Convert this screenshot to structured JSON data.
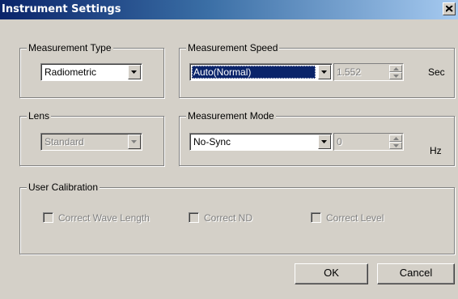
{
  "window": {
    "title": "Instrument Settings"
  },
  "measurement_type": {
    "label": "Measurement Type",
    "value": "Radiometric"
  },
  "measurement_speed": {
    "label": "Measurement Speed",
    "value": "Auto(Normal)",
    "time_value": "1.552",
    "unit": "Sec"
  },
  "lens": {
    "label": "Lens",
    "value": "Standard"
  },
  "measurement_mode": {
    "label": "Measurement Mode",
    "value": "No-Sync",
    "freq_value": "0",
    "unit": "Hz"
  },
  "user_calibration": {
    "label": "User Calibration",
    "options": [
      {
        "label": "Correct Wave Length",
        "checked": false,
        "enabled": false
      },
      {
        "label": "Correct ND",
        "checked": false,
        "enabled": false
      },
      {
        "label": "Correct Level",
        "checked": false,
        "enabled": false
      }
    ]
  },
  "buttons": {
    "ok": "OK",
    "cancel": "Cancel"
  },
  "icons": {
    "close": "close-icon",
    "dropdown": "chevron-down-icon",
    "spin_up": "spin-up-icon",
    "spin_down": "spin-down-icon"
  }
}
